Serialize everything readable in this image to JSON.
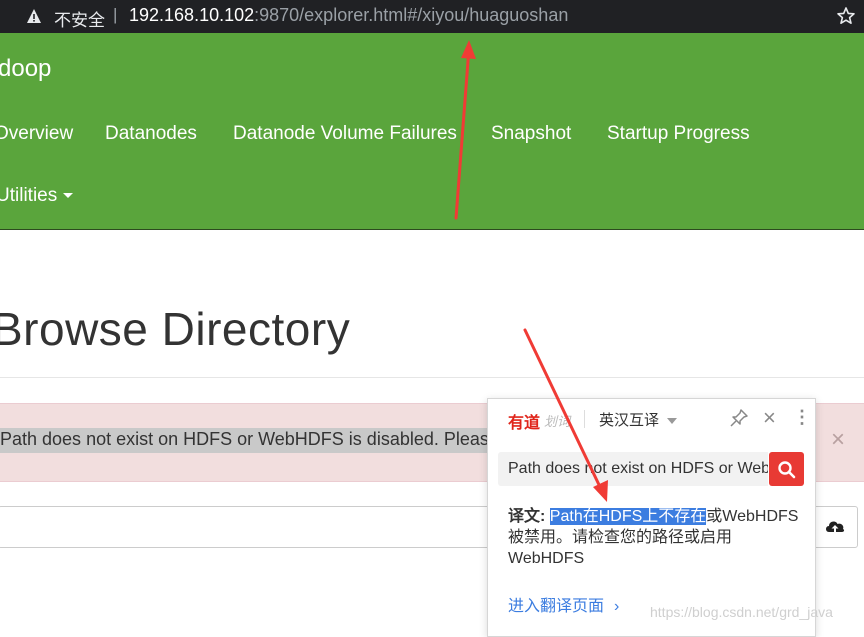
{
  "browser": {
    "insecure_label": "不安全",
    "separator": "|",
    "url_host": "192.168.10.102",
    "url_rest": ":9870/explorer.html#/xiyou/huaguoshan"
  },
  "navbar": {
    "brand": "doop",
    "items": [
      "Overview",
      "Datanodes",
      "Datanode Volume Failures",
      "Snapshot",
      "Startup Progress"
    ],
    "utilities": "Utilities",
    "bg_color": "#5aa53c"
  },
  "page": {
    "title": "Browse Directory",
    "alert_text": "Path does not exist on HDFS or WebHDFS is disabled. Please check your path or enable WebHDFS",
    "alert_close": "×"
  },
  "youdao": {
    "logo": "有道",
    "sub": "划词",
    "mode": "英汉互译",
    "close": "×",
    "more": "⋮",
    "input_text": "Path does not exist on HDFS or WebHDFS is disabled. Please check your path or enable WebHDFS",
    "result_label": "译文:",
    "result_highlight": "Path在HDFS上不存在",
    "result_rest": "或WebHDFS被禁用。请检查您的路径或启用WebHDFS",
    "link": "进入翻译页面",
    "link_chevron": "›"
  },
  "watermark": "https://blog.csdn.net/grd_java",
  "colors": {
    "accent_red": "#e83a34",
    "highlight_blue": "#3c7de0",
    "arrow_red": "#f03b35"
  }
}
